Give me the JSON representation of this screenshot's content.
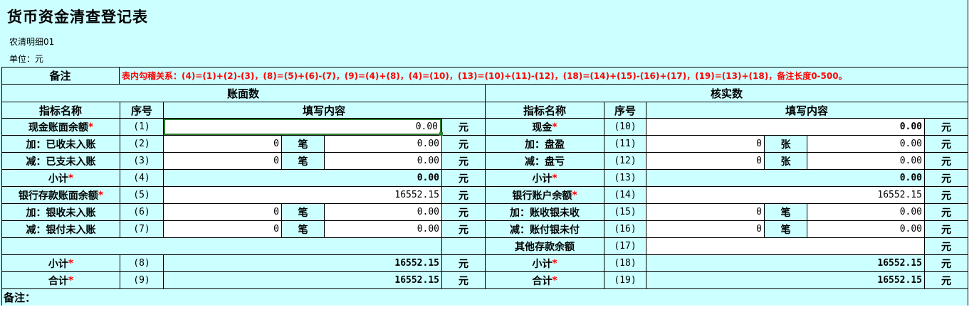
{
  "title": "货币资金清查登记表",
  "subtitle": "农清明细01",
  "unit": "单位：元",
  "note_label": "备注",
  "rule_text": "表内勾稽关系：(4)=(1)+(2)-(3)，(8)=(5)+(6)-(7)，(9)=(4)+(8)，(4)=(10)，(13)=(10)+(11)-(12)，(18)=(14)+(15)-(16)+(17)，(19)=(13)+(18)，备注长度0-500。",
  "book_header": "账面数",
  "verify_header": "核实数",
  "col_headers": {
    "name": "指标名称",
    "seq": "序号",
    "content": "填写内容"
  },
  "star": "*",
  "yuan": "元",
  "bi": "笔",
  "zhang": "张",
  "left_rows": [
    {
      "name": "现金账面余额",
      "required": true,
      "seq": "(1)",
      "amount": "0.00"
    },
    {
      "name": "加：已收未入账",
      "required": false,
      "seq": "(2)",
      "count": "0",
      "amount": "0.00"
    },
    {
      "name": "减：已支未入账",
      "required": false,
      "seq": "(3)",
      "count": "0",
      "amount": "0.00"
    },
    {
      "name": "小计",
      "required": true,
      "seq": "(4)",
      "amount": "0.00"
    },
    {
      "name": "银行存款账面余额",
      "required": true,
      "seq": "(5)",
      "amount": "16552.15"
    },
    {
      "name": "加：银收未入账",
      "required": false,
      "seq": "(6)",
      "count": "0",
      "amount": "0.00"
    },
    {
      "name": "减：银付未入账",
      "required": false,
      "seq": "(7)",
      "count": "0",
      "amount": "0.00"
    },
    {
      "name": "小计",
      "required": true,
      "seq": "(8)",
      "amount": "16552.15"
    },
    {
      "name": "合计",
      "required": true,
      "seq": "(9)",
      "amount": "16552.15"
    }
  ],
  "right_rows": [
    {
      "name": "现金",
      "required": true,
      "seq": "(10)",
      "amount": "0.00"
    },
    {
      "name": "加：盘盈",
      "required": false,
      "seq": "(11)",
      "count": "0",
      "amount": "0.00"
    },
    {
      "name": "减：盘亏",
      "required": false,
      "seq": "(12)",
      "count": "0",
      "amount": "0.00"
    },
    {
      "name": "小计",
      "required": true,
      "seq": "(13)",
      "amount": "0.00"
    },
    {
      "name": "银行账户余额",
      "required": true,
      "seq": "(14)",
      "amount": "16552.15"
    },
    {
      "name": "加：账收银未收",
      "required": false,
      "seq": "(15)",
      "count": "0",
      "amount": "0.00"
    },
    {
      "name": "减：账付银未付",
      "required": false,
      "seq": "(16)",
      "count": "0",
      "amount": "0.00"
    },
    {
      "name": "其他存款余额",
      "required": false,
      "seq": "(17)",
      "amount": ""
    },
    {
      "name": "小计",
      "required": true,
      "seq": "(18)",
      "amount": "16552.15"
    },
    {
      "name": "合计",
      "required": true,
      "seq": "(19)",
      "amount": "16552.15"
    }
  ],
  "remark_label": "备注："
}
